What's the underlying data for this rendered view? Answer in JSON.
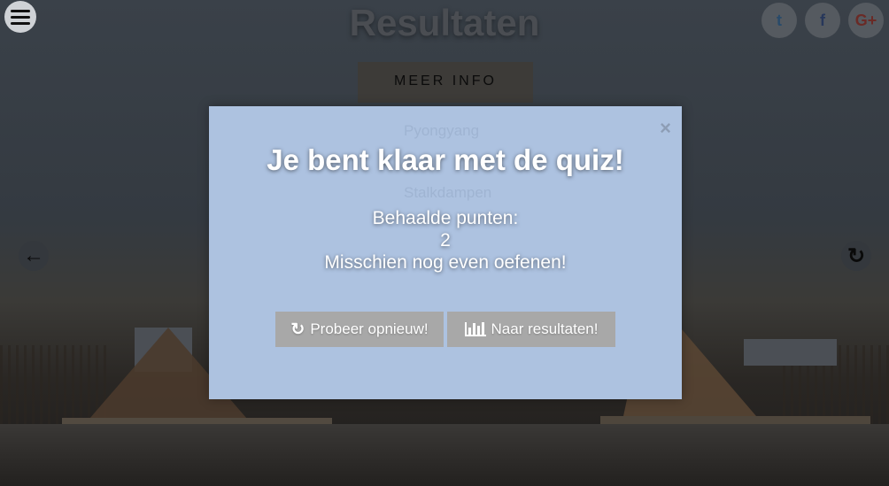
{
  "page": {
    "title": "Resultaten",
    "more_info_label": "MEER INFO"
  },
  "social": {
    "twitter_glyph": "t",
    "facebook_glyph": "f",
    "google_glyph": "G+"
  },
  "background_ghost_text": [
    "Pyongyang",
    "Stalkdampen"
  ],
  "modal": {
    "close_glyph": "×",
    "heading": "Je bent klaar met de quiz!",
    "score_label": "Behaalde punten:",
    "score_value": "2",
    "feedback": "Misschien nog even oefenen!",
    "retry_label": "Probeer opnieuw!",
    "results_label": "Naar resultaten!"
  },
  "icons": {
    "menu": "hamburger-icon",
    "prev": "arrow-left-icon",
    "reload": "refresh-icon",
    "retry": "refresh-icon",
    "results": "bar-chart-icon"
  },
  "colors": {
    "modal_background": "#adc2e0",
    "button_background": "#a8a8a8",
    "overlay": "#2b2f35"
  }
}
